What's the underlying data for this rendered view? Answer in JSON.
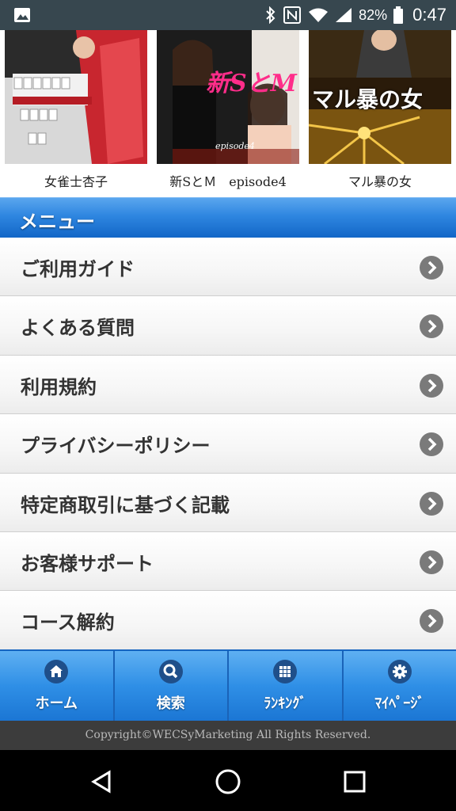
{
  "status_bar": {
    "battery_percent": "82%",
    "time": "0:47",
    "icons": [
      "image-notification-icon",
      "bluetooth-icon",
      "nfc-icon",
      "wifi-icon",
      "cellular-signal-icon",
      "battery-icon"
    ]
  },
  "movies": [
    {
      "title": "女雀士杏子"
    },
    {
      "title": "新SとＭ　episode4",
      "poster_text": "新SとM",
      "poster_sub": "episode4"
    },
    {
      "title": "マル暴の女",
      "poster_text": "マル暴の女"
    }
  ],
  "menu": {
    "header": "メニュー",
    "items": [
      {
        "label": "ご利用ガイド"
      },
      {
        "label": "よくある質問"
      },
      {
        "label": "利用規約"
      },
      {
        "label": "プライバシーポリシー"
      },
      {
        "label": "特定商取引に基づく記載"
      },
      {
        "label": "お客様サポート"
      },
      {
        "label": "コース解約"
      }
    ]
  },
  "tabbar": {
    "tabs": [
      {
        "label": "ホーム",
        "icon": "home-icon"
      },
      {
        "label": "検索",
        "icon": "search-icon"
      },
      {
        "label": "ﾗﾝｷﾝｸﾞ",
        "icon": "grid-icon"
      },
      {
        "label": "ﾏｲﾍﾟｰｼﾞ",
        "icon": "gear-icon"
      }
    ]
  },
  "footer": {
    "copyright": "Copyright©WECSyMarketing All Rights Reserved."
  },
  "colors": {
    "accent": "#1e7ad8",
    "status_bar": "#37474f",
    "footer": "#3c3c3c"
  }
}
